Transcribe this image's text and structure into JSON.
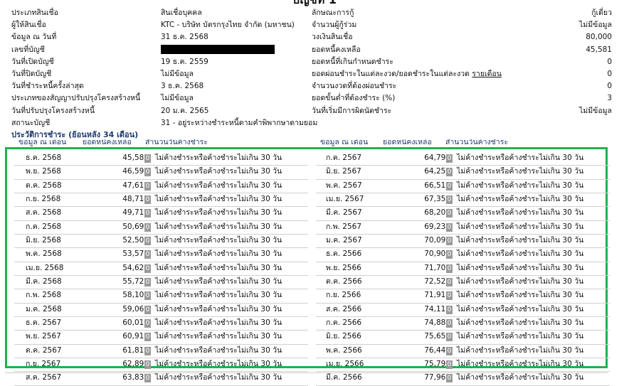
{
  "account_title": "บัญชีที่ 1",
  "info_rows": [
    {
      "label1": "ประเภทสินเชื่อ",
      "value1": "สินเชื่อบุคคล",
      "label2": "ลักษณะการกู้",
      "value2": "กู้เดี่ยว"
    },
    {
      "label1": "ผู้ให้สินเชื่อ",
      "value1": "KTC - บริษัท บัตรกรุงไทย จำกัด (มหาชน)",
      "label2": "จำนวนผู้กู้ร่วม",
      "value2": "ไม่มีข้อมูล"
    },
    {
      "label1": "ข้อมูล ณ วันที่",
      "value1": "31 ธ.ค. 2568",
      "label2": "วงเงินสินเชื่อ",
      "value2": "80,000"
    },
    {
      "label1": "เลขที่บัญชี",
      "value1": "",
      "label2": "ยอดหนี้คงเหลือ",
      "value2": "45,581"
    },
    {
      "label1": "วันที่เปิดบัญชี",
      "value1": "19 ธ.ค. 2559",
      "label2": "ยอดหนี้ที่เกินกำหนดชำระ",
      "value2": "0"
    },
    {
      "label1": "วันที่ปิดบัญชี",
      "value1": "ไม่มีข้อมูล",
      "label2": "ยอดผ่อนชำระในแต่ละงวด/ยอดชำระในแต่ละงวด",
      "label2_link": "รายเดือน",
      "value2": "0"
    },
    {
      "label1": "วันที่ชำระหนี้ครั้งล่าสุด",
      "value1": "3 ธ.ค. 2568",
      "label2": "จำนวนงวดที่ต้องผ่อนชำระ",
      "value2": "0"
    },
    {
      "label1": "ประเภทของสัญญาปรับปรุงโครงสร้างหนี้",
      "value1": "ไม่มีข้อมูล",
      "label2": "ยอดขั้นต่ำที่ต้องชำระ (%)",
      "value2": "3"
    },
    {
      "label1": "วันที่ปรับปรุงโครงสร้างหนี้",
      "value1": "20 ม.ค. 2565",
      "label2": "วันที่เริ่มมีการผิดนัดชำระ",
      "value2": "ไม่มีข้อมูล"
    },
    {
      "label1": "สถานะบัญชี",
      "value1": "31 - อยู่ระหว่างชำระหนี้ตามคำพิพากษาตามยอม",
      "label2": "",
      "value2": ""
    }
  ],
  "history": {
    "title": "ประวัติการชำระ (ย้อนหลัง 34 เดือน)",
    "headers": {
      "date": "ข้อมูล ณ เดือน",
      "balance": "ยอดหนี้คงเหลือ",
      "status": "สำนวนวันค้างชำระ"
    },
    "status_text": "ไม่ค้างชำระหรือค้างชำระไม่เกิน 30 วัน",
    "days_badge": "0",
    "left": [
      {
        "date": "ธ.ค. 2568",
        "balance": "45,581"
      },
      {
        "date": "พ.ย. 2568",
        "balance": "46,597"
      },
      {
        "date": "ต.ค. 2568",
        "balance": "47,615"
      },
      {
        "date": "ก.ย. 2568",
        "balance": "48,712"
      },
      {
        "date": "ส.ค. 2568",
        "balance": "49,713"
      },
      {
        "date": "ก.ค. 2568",
        "balance": "50,692"
      },
      {
        "date": "มิ.ย. 2568",
        "balance": "52,506"
      },
      {
        "date": "พ.ค. 2568",
        "balance": "53,576"
      },
      {
        "date": "เม.ย. 2568",
        "balance": "54,624"
      },
      {
        "date": "มี.ค. 2568",
        "balance": "55,726"
      },
      {
        "date": "ก.พ. 2568",
        "balance": "58,109"
      },
      {
        "date": "ม.ค. 2568",
        "balance": "59,066"
      },
      {
        "date": "ธ.ค. 2567",
        "balance": "60,016"
      },
      {
        "date": "พ.ย. 2567",
        "balance": "60,910"
      },
      {
        "date": "ต.ค. 2567",
        "balance": "61,813"
      },
      {
        "date": "ก.ย. 2567",
        "balance": "62,892"
      },
      {
        "date": "ส.ค. 2567",
        "balance": "63,830"
      }
    ],
    "right": [
      {
        "date": "ก.ค. 2567",
        "balance": "64,794"
      },
      {
        "date": "มิ.ย. 2567",
        "balance": "64,250"
      },
      {
        "date": "พ.ค. 2567",
        "balance": "66,516"
      },
      {
        "date": "เม.ย. 2567",
        "balance": "67,357"
      },
      {
        "date": "มี.ค. 2567",
        "balance": "68,209"
      },
      {
        "date": "ก.พ. 2567",
        "balance": "69,236"
      },
      {
        "date": "ม.ค. 2567",
        "balance": "70,091"
      },
      {
        "date": "ธ.ค. 2566",
        "balance": "70,902"
      },
      {
        "date": "พ.ย. 2566",
        "balance": "71,705"
      },
      {
        "date": "ต.ค. 2566",
        "balance": "72,520"
      },
      {
        "date": "ก.ย. 2566",
        "balance": "71,910"
      },
      {
        "date": "ส.ค. 2566",
        "balance": "74,112"
      },
      {
        "date": "ก.ค. 2566",
        "balance": "74,888"
      },
      {
        "date": "มิ.ย. 2566",
        "balance": "75,657"
      },
      {
        "date": "พ.ค. 2566",
        "balance": "76,440"
      },
      {
        "date": "เม.ย. 2566",
        "balance": "75,796"
      },
      {
        "date": "มี.ค. 2566",
        "balance": "77,967"
      }
    ]
  },
  "colors": {
    "highlight_border": "#22b04b",
    "section_title": "#1f3b6e",
    "badge": "#9a9a9a"
  }
}
